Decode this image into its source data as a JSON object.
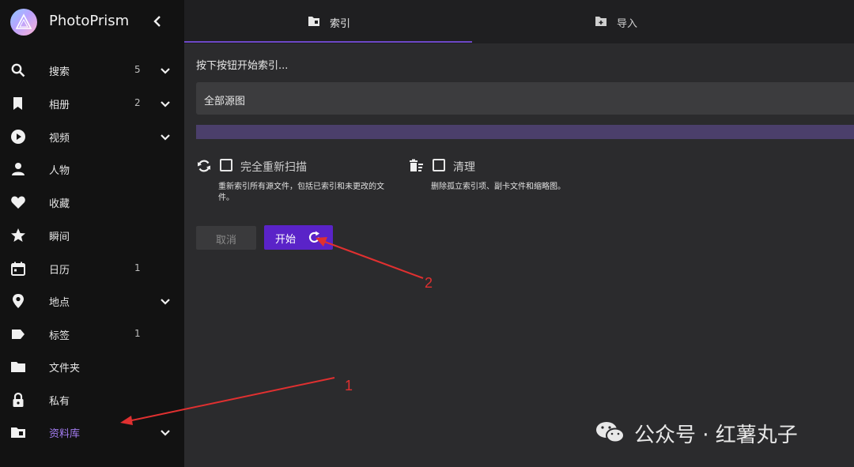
{
  "app": {
    "name": "PhotoPrism"
  },
  "sidebar": {
    "items": [
      {
        "label": "搜索",
        "count": "5",
        "icon": "search-icon",
        "expandable": true
      },
      {
        "label": "相册",
        "count": "2",
        "icon": "bookmark-icon",
        "expandable": true
      },
      {
        "label": "视频",
        "count": "",
        "icon": "play-circle-icon",
        "expandable": true
      },
      {
        "label": "人物",
        "count": "",
        "icon": "person-icon",
        "expandable": false
      },
      {
        "label": "收藏",
        "count": "",
        "icon": "heart-icon",
        "expandable": false
      },
      {
        "label": "瞬间",
        "count": "",
        "icon": "star-icon",
        "expandable": false
      },
      {
        "label": "日历",
        "count": "1",
        "icon": "calendar-icon",
        "expandable": false
      },
      {
        "label": "地点",
        "count": "",
        "icon": "location-pin-icon",
        "expandable": true
      },
      {
        "label": "标签",
        "count": "1",
        "icon": "tag-icon",
        "expandable": false
      },
      {
        "label": "文件夹",
        "count": "",
        "icon": "folder-icon",
        "expandable": false
      },
      {
        "label": "私有",
        "count": "",
        "icon": "lock-icon",
        "expandable": false
      },
      {
        "label": "资料库",
        "count": "",
        "icon": "library-folder-icon",
        "expandable": true,
        "active": true
      }
    ]
  },
  "tabs": [
    {
      "label": "索引",
      "icon": "index-folder-icon",
      "active": true
    },
    {
      "label": "导入",
      "icon": "import-folder-icon",
      "active": false
    }
  ],
  "index": {
    "hint": "按下按钮开始索引...",
    "source_select": "全部源图",
    "options": [
      {
        "label": "完全重新扫描",
        "description_lines": [
          "重新索引所有源文件，包括已索引和未更改的文",
          "件。"
        ],
        "icon": "rescan-icon",
        "checked": false
      },
      {
        "label": "清理",
        "description_lines": [
          "删除孤立索引项、副卡文件和缩略图。"
        ],
        "icon": "cleanup-icon",
        "checked": false
      }
    ],
    "cancel_label": "取消",
    "start_label": "开始"
  },
  "annotations": {
    "marker_1": "1",
    "marker_2": "2"
  },
  "watermark": {
    "text": "公众号 · 红薯丸子"
  },
  "colors": {
    "accent": "#5a23c8",
    "active_text": "#a37cf0",
    "annotation": "#e03030"
  }
}
